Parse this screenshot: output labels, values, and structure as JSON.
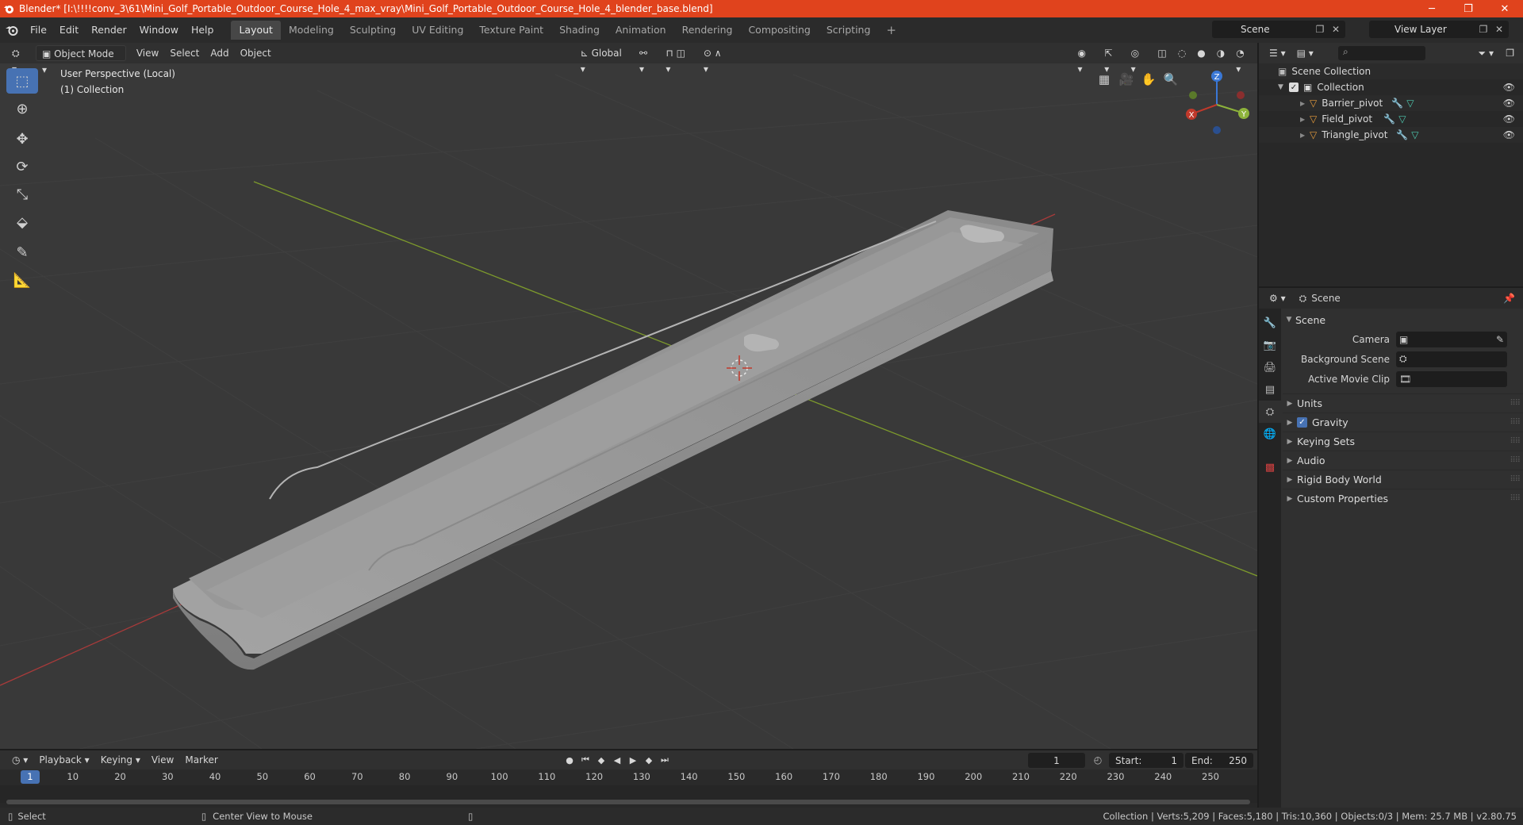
{
  "window": {
    "title": "Blender* [I:\\!!!!conv_3\\61\\Mini_Golf_Portable_Outdoor_Course_Hole_4_max_vray\\Mini_Golf_Portable_Outdoor_Course_Hole_4_blender_base.blend]",
    "minimize": "─",
    "maximize": "❐",
    "close": "✕"
  },
  "menu": [
    "File",
    "Edit",
    "Render",
    "Window",
    "Help"
  ],
  "workspaces": [
    "Layout",
    "Modeling",
    "Sculpting",
    "UV Editing",
    "Texture Paint",
    "Shading",
    "Animation",
    "Rendering",
    "Compositing",
    "Scripting"
  ],
  "active_workspace": "Layout",
  "add_workspace": "+",
  "scene": {
    "label": "Scene"
  },
  "view_layer": {
    "label": "View Layer"
  },
  "viewport": {
    "mode": "Object Mode",
    "menus": [
      "View",
      "Select",
      "Add",
      "Object"
    ],
    "transform_orientation": "Global",
    "info_line1": "User Perspective (Local)",
    "info_line2": "(1) Collection",
    "gizmo": {
      "x": "X",
      "y": "Y",
      "z": "Z"
    }
  },
  "outliner": {
    "root": "Scene Collection",
    "collection": "Collection",
    "items": [
      "Barrier_pivot",
      "Field_pivot",
      "Triangle_pivot"
    ]
  },
  "properties": {
    "header": "Scene",
    "panel": "Scene",
    "camera_label": "Camera",
    "background_scene_label": "Background Scene",
    "active_movie_clip_label": "Active Movie Clip",
    "subpanels": [
      "Units",
      "Gravity",
      "Keying Sets",
      "Audio",
      "Rigid Body World",
      "Custom Properties"
    ],
    "gravity_checked": true
  },
  "timeline": {
    "menus": [
      "Playback",
      "Keying",
      "View",
      "Marker"
    ],
    "current_frame": "1",
    "start_label": "Start:",
    "start": "1",
    "end_label": "End:",
    "end": "250",
    "ticks": [
      "10",
      "20",
      "30",
      "40",
      "50",
      "60",
      "70",
      "80",
      "90",
      "100",
      "110",
      "120",
      "130",
      "140",
      "150",
      "160",
      "170",
      "180",
      "190",
      "200",
      "210",
      "220",
      "230",
      "240",
      "250"
    ],
    "cursor_label": "1"
  },
  "statusbar": {
    "select": "Select",
    "center_view": "Center View to Mouse",
    "stats": "Collection | Verts:5,209 | Faces:5,180 | Tris:10,360 | Objects:0/3 | Mem: 25.7 MB | v2.80.75"
  },
  "colors": {
    "titlebar": "#e0431d",
    "accent": "#4772b3",
    "x_axis": "#c0392b",
    "y_axis": "#8db33b",
    "z_axis": "#3a78d6"
  }
}
